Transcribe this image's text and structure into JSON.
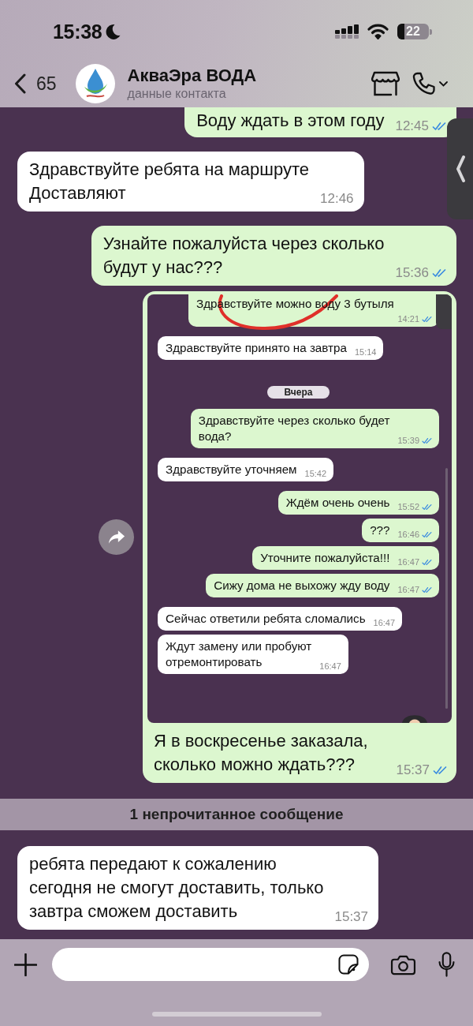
{
  "status_bar": {
    "time": "15:38",
    "battery": "22"
  },
  "header": {
    "back_count": "65",
    "title": "АкваЭра ВОДА",
    "subtitle": "данные контакта"
  },
  "messages": [
    {
      "kind": "text",
      "outgoing": true,
      "text": "Воду ждать в этом году",
      "time": "12:45",
      "read": true
    },
    {
      "kind": "text",
      "outgoing": false,
      "text": "Здравствуйте ребята на маршруте\nДоставляют",
      "time": "12:46"
    },
    {
      "kind": "text",
      "outgoing": true,
      "text": "Узнайте пожалуйста через сколько\nбудут у нас???",
      "time": "15:36",
      "read": true
    },
    {
      "kind": "screenshot",
      "outgoing": true,
      "screenshot": {
        "messages": [
          {
            "kind": "text",
            "outgoing": true,
            "text": "Здравствуйте можно воду 3 бутыля",
            "time": "14:21",
            "read": true
          },
          {
            "kind": "text",
            "outgoing": false,
            "text": "Здравствуйте принято на завтра",
            "time": "15:14"
          },
          {
            "kind": "date",
            "text": "Вчера"
          },
          {
            "kind": "text",
            "outgoing": true,
            "text": "Здравствуйте через сколько будет\nвода?",
            "time": "15:39",
            "read": true
          },
          {
            "kind": "text",
            "outgoing": false,
            "text": "Здравствуйте уточняем",
            "time": "15:42"
          },
          {
            "kind": "text",
            "outgoing": true,
            "text": "Ждём очень очень",
            "time": "15:52",
            "read": true
          },
          {
            "kind": "text",
            "outgoing": true,
            "text": "???",
            "time": "16:46",
            "read": true
          },
          {
            "kind": "text",
            "outgoing": true,
            "text": "Уточните пожалуйста!!!",
            "time": "16:47",
            "read": true
          },
          {
            "kind": "text",
            "outgoing": true,
            "text": "Сижу дома не выхожу жду воду",
            "time": "16:47",
            "read": true
          },
          {
            "kind": "text",
            "outgoing": false,
            "text": "Сейчас ответили ребята сломались",
            "time": "16:47"
          },
          {
            "kind": "text",
            "outgoing": false,
            "text": "Ждут замену или пробуют\nотремонтировать",
            "time": "16:47"
          }
        ]
      },
      "caption": "Я в воскресенье заказала,\nсколько можно ждать???",
      "time": "15:37",
      "read": true
    },
    {
      "kind": "divider",
      "text": "1 непрочитанное сообщение"
    },
    {
      "kind": "text",
      "outgoing": false,
      "text": "ребята передают к сожалению\nсегодня не смогут доставить, только\nзавтра сможем доставить",
      "time": "15:37"
    }
  ]
}
